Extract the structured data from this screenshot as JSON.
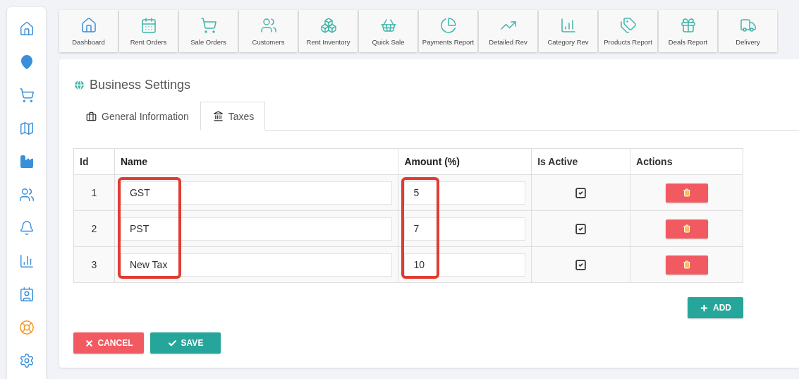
{
  "toolbar": [
    {
      "label": "Dashboard"
    },
    {
      "label": "Rent Orders"
    },
    {
      "label": "Sale Orders"
    },
    {
      "label": "Customers"
    },
    {
      "label": "Rent Inventory"
    },
    {
      "label": "Quick Sale"
    },
    {
      "label": "Payments Report"
    },
    {
      "label": "Detailed Rev"
    },
    {
      "label": "Category Rev"
    },
    {
      "label": "Products Report"
    },
    {
      "label": "Deals Report"
    },
    {
      "label": "Delivery"
    }
  ],
  "page": {
    "title": "Business Settings"
  },
  "tabs": [
    {
      "label": "General Information",
      "selected": false
    },
    {
      "label": "Taxes",
      "selected": true
    }
  ],
  "table": {
    "columns": [
      {
        "label": "Id",
        "highlighted": false
      },
      {
        "label": "Name",
        "highlighted": true
      },
      {
        "label": "Amount (%)",
        "highlighted": true
      },
      {
        "label": "Is Active",
        "highlighted": false
      },
      {
        "label": "Actions",
        "highlighted": false
      }
    ],
    "rows": [
      {
        "id": "1",
        "name": "GST",
        "amount": "5",
        "active": true
      },
      {
        "id": "2",
        "name": "PST",
        "amount": "7",
        "active": true
      },
      {
        "id": "3",
        "name": "New Tax",
        "amount": "10",
        "active": true
      }
    ]
  },
  "add_button": "ADD",
  "buttons": [
    {
      "label": "CANCEL",
      "kind": "cancel"
    },
    {
      "label": "SAVE",
      "kind": "save"
    }
  ]
}
